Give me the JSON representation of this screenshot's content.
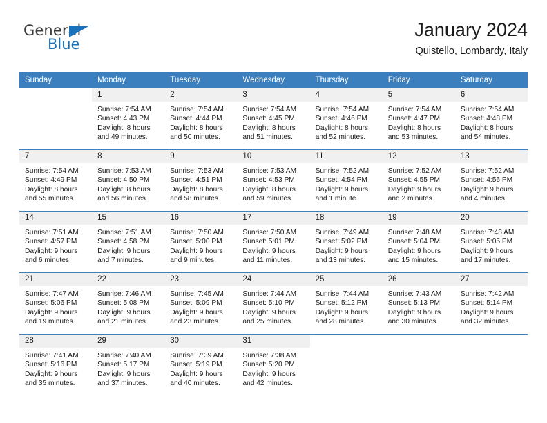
{
  "brand": {
    "word_one": "General",
    "word_two": "Blue",
    "triangle_color": "#1a72bb",
    "text_color": "#3c3c3c"
  },
  "header": {
    "title": "January 2024",
    "subtitle": "Quistello, Lombardy, Italy"
  },
  "theme": {
    "header_bg": "#3c7fbe",
    "daynum_bg": "#f0f0f0",
    "text": "#1a1a1a"
  },
  "weekdays": [
    "Sunday",
    "Monday",
    "Tuesday",
    "Wednesday",
    "Thursday",
    "Friday",
    "Saturday"
  ],
  "labels": {
    "sunrise_prefix": "Sunrise:",
    "sunset_prefix": "Sunset:",
    "daylight_prefix": "Daylight:"
  },
  "weeks": [
    [
      {
        "day": "",
        "sunrise": "",
        "sunset": "",
        "daylight_line1": "",
        "daylight_line2": ""
      },
      {
        "day": "1",
        "sunrise": "Sunrise: 7:54 AM",
        "sunset": "Sunset: 4:43 PM",
        "daylight_line1": "Daylight: 8 hours",
        "daylight_line2": "and 49 minutes."
      },
      {
        "day": "2",
        "sunrise": "Sunrise: 7:54 AM",
        "sunset": "Sunset: 4:44 PM",
        "daylight_line1": "Daylight: 8 hours",
        "daylight_line2": "and 50 minutes."
      },
      {
        "day": "3",
        "sunrise": "Sunrise: 7:54 AM",
        "sunset": "Sunset: 4:45 PM",
        "daylight_line1": "Daylight: 8 hours",
        "daylight_line2": "and 51 minutes."
      },
      {
        "day": "4",
        "sunrise": "Sunrise: 7:54 AM",
        "sunset": "Sunset: 4:46 PM",
        "daylight_line1": "Daylight: 8 hours",
        "daylight_line2": "and 52 minutes."
      },
      {
        "day": "5",
        "sunrise": "Sunrise: 7:54 AM",
        "sunset": "Sunset: 4:47 PM",
        "daylight_line1": "Daylight: 8 hours",
        "daylight_line2": "and 53 minutes."
      },
      {
        "day": "6",
        "sunrise": "Sunrise: 7:54 AM",
        "sunset": "Sunset: 4:48 PM",
        "daylight_line1": "Daylight: 8 hours",
        "daylight_line2": "and 54 minutes."
      }
    ],
    [
      {
        "day": "7",
        "sunrise": "Sunrise: 7:54 AM",
        "sunset": "Sunset: 4:49 PM",
        "daylight_line1": "Daylight: 8 hours",
        "daylight_line2": "and 55 minutes."
      },
      {
        "day": "8",
        "sunrise": "Sunrise: 7:53 AM",
        "sunset": "Sunset: 4:50 PM",
        "daylight_line1": "Daylight: 8 hours",
        "daylight_line2": "and 56 minutes."
      },
      {
        "day": "9",
        "sunrise": "Sunrise: 7:53 AM",
        "sunset": "Sunset: 4:51 PM",
        "daylight_line1": "Daylight: 8 hours",
        "daylight_line2": "and 58 minutes."
      },
      {
        "day": "10",
        "sunrise": "Sunrise: 7:53 AM",
        "sunset": "Sunset: 4:53 PM",
        "daylight_line1": "Daylight: 8 hours",
        "daylight_line2": "and 59 minutes."
      },
      {
        "day": "11",
        "sunrise": "Sunrise: 7:52 AM",
        "sunset": "Sunset: 4:54 PM",
        "daylight_line1": "Daylight: 9 hours",
        "daylight_line2": "and 1 minute."
      },
      {
        "day": "12",
        "sunrise": "Sunrise: 7:52 AM",
        "sunset": "Sunset: 4:55 PM",
        "daylight_line1": "Daylight: 9 hours",
        "daylight_line2": "and 2 minutes."
      },
      {
        "day": "13",
        "sunrise": "Sunrise: 7:52 AM",
        "sunset": "Sunset: 4:56 PM",
        "daylight_line1": "Daylight: 9 hours",
        "daylight_line2": "and 4 minutes."
      }
    ],
    [
      {
        "day": "14",
        "sunrise": "Sunrise: 7:51 AM",
        "sunset": "Sunset: 4:57 PM",
        "daylight_line1": "Daylight: 9 hours",
        "daylight_line2": "and 6 minutes."
      },
      {
        "day": "15",
        "sunrise": "Sunrise: 7:51 AM",
        "sunset": "Sunset: 4:58 PM",
        "daylight_line1": "Daylight: 9 hours",
        "daylight_line2": "and 7 minutes."
      },
      {
        "day": "16",
        "sunrise": "Sunrise: 7:50 AM",
        "sunset": "Sunset: 5:00 PM",
        "daylight_line1": "Daylight: 9 hours",
        "daylight_line2": "and 9 minutes."
      },
      {
        "day": "17",
        "sunrise": "Sunrise: 7:50 AM",
        "sunset": "Sunset: 5:01 PM",
        "daylight_line1": "Daylight: 9 hours",
        "daylight_line2": "and 11 minutes."
      },
      {
        "day": "18",
        "sunrise": "Sunrise: 7:49 AM",
        "sunset": "Sunset: 5:02 PM",
        "daylight_line1": "Daylight: 9 hours",
        "daylight_line2": "and 13 minutes."
      },
      {
        "day": "19",
        "sunrise": "Sunrise: 7:48 AM",
        "sunset": "Sunset: 5:04 PM",
        "daylight_line1": "Daylight: 9 hours",
        "daylight_line2": "and 15 minutes."
      },
      {
        "day": "20",
        "sunrise": "Sunrise: 7:48 AM",
        "sunset": "Sunset: 5:05 PM",
        "daylight_line1": "Daylight: 9 hours",
        "daylight_line2": "and 17 minutes."
      }
    ],
    [
      {
        "day": "21",
        "sunrise": "Sunrise: 7:47 AM",
        "sunset": "Sunset: 5:06 PM",
        "daylight_line1": "Daylight: 9 hours",
        "daylight_line2": "and 19 minutes."
      },
      {
        "day": "22",
        "sunrise": "Sunrise: 7:46 AM",
        "sunset": "Sunset: 5:08 PM",
        "daylight_line1": "Daylight: 9 hours",
        "daylight_line2": "and 21 minutes."
      },
      {
        "day": "23",
        "sunrise": "Sunrise: 7:45 AM",
        "sunset": "Sunset: 5:09 PM",
        "daylight_line1": "Daylight: 9 hours",
        "daylight_line2": "and 23 minutes."
      },
      {
        "day": "24",
        "sunrise": "Sunrise: 7:44 AM",
        "sunset": "Sunset: 5:10 PM",
        "daylight_line1": "Daylight: 9 hours",
        "daylight_line2": "and 25 minutes."
      },
      {
        "day": "25",
        "sunrise": "Sunrise: 7:44 AM",
        "sunset": "Sunset: 5:12 PM",
        "daylight_line1": "Daylight: 9 hours",
        "daylight_line2": "and 28 minutes."
      },
      {
        "day": "26",
        "sunrise": "Sunrise: 7:43 AM",
        "sunset": "Sunset: 5:13 PM",
        "daylight_line1": "Daylight: 9 hours",
        "daylight_line2": "and 30 minutes."
      },
      {
        "day": "27",
        "sunrise": "Sunrise: 7:42 AM",
        "sunset": "Sunset: 5:14 PM",
        "daylight_line1": "Daylight: 9 hours",
        "daylight_line2": "and 32 minutes."
      }
    ],
    [
      {
        "day": "28",
        "sunrise": "Sunrise: 7:41 AM",
        "sunset": "Sunset: 5:16 PM",
        "daylight_line1": "Daylight: 9 hours",
        "daylight_line2": "and 35 minutes."
      },
      {
        "day": "29",
        "sunrise": "Sunrise: 7:40 AM",
        "sunset": "Sunset: 5:17 PM",
        "daylight_line1": "Daylight: 9 hours",
        "daylight_line2": "and 37 minutes."
      },
      {
        "day": "30",
        "sunrise": "Sunrise: 7:39 AM",
        "sunset": "Sunset: 5:19 PM",
        "daylight_line1": "Daylight: 9 hours",
        "daylight_line2": "and 40 minutes."
      },
      {
        "day": "31",
        "sunrise": "Sunrise: 7:38 AM",
        "sunset": "Sunset: 5:20 PM",
        "daylight_line1": "Daylight: 9 hours",
        "daylight_line2": "and 42 minutes."
      },
      {
        "day": "",
        "sunrise": "",
        "sunset": "",
        "daylight_line1": "",
        "daylight_line2": ""
      },
      {
        "day": "",
        "sunrise": "",
        "sunset": "",
        "daylight_line1": "",
        "daylight_line2": ""
      },
      {
        "day": "",
        "sunrise": "",
        "sunset": "",
        "daylight_line1": "",
        "daylight_line2": ""
      }
    ]
  ]
}
